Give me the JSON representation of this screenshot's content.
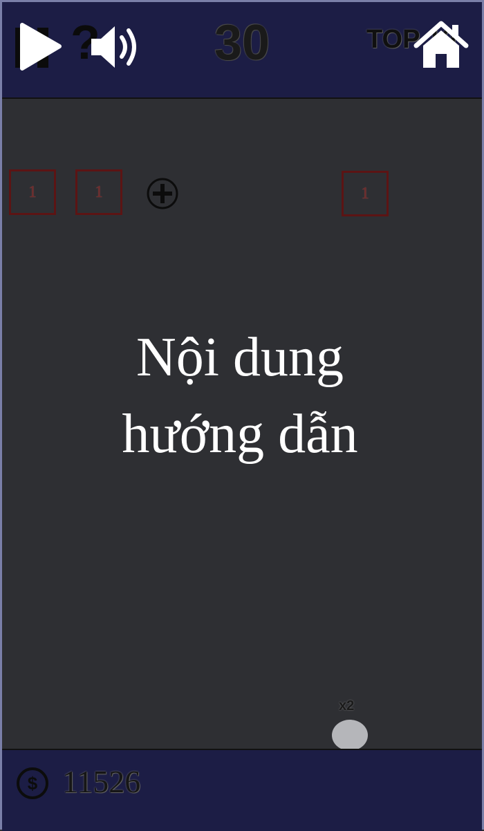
{
  "topbar": {
    "level": "30",
    "top_label": "TOP 10",
    "icons": [
      "play-icon",
      "pause-icon",
      "help-icon",
      "sound-icon",
      "home-icon"
    ],
    "help_glyph": "?"
  },
  "board": {
    "blocks": [
      {
        "value": "1"
      },
      {
        "value": "1"
      },
      {
        "value": "1"
      }
    ],
    "overlay_line1": "Nội dung",
    "overlay_line2": "hướng dẫn",
    "multiplier": "x2"
  },
  "bottombar": {
    "coins": "11526"
  },
  "colors": {
    "bar_background": "#1c1d45",
    "board_background": "#2e2f33",
    "block_border": "#5c1414",
    "text_overlay": "#ffffff"
  }
}
